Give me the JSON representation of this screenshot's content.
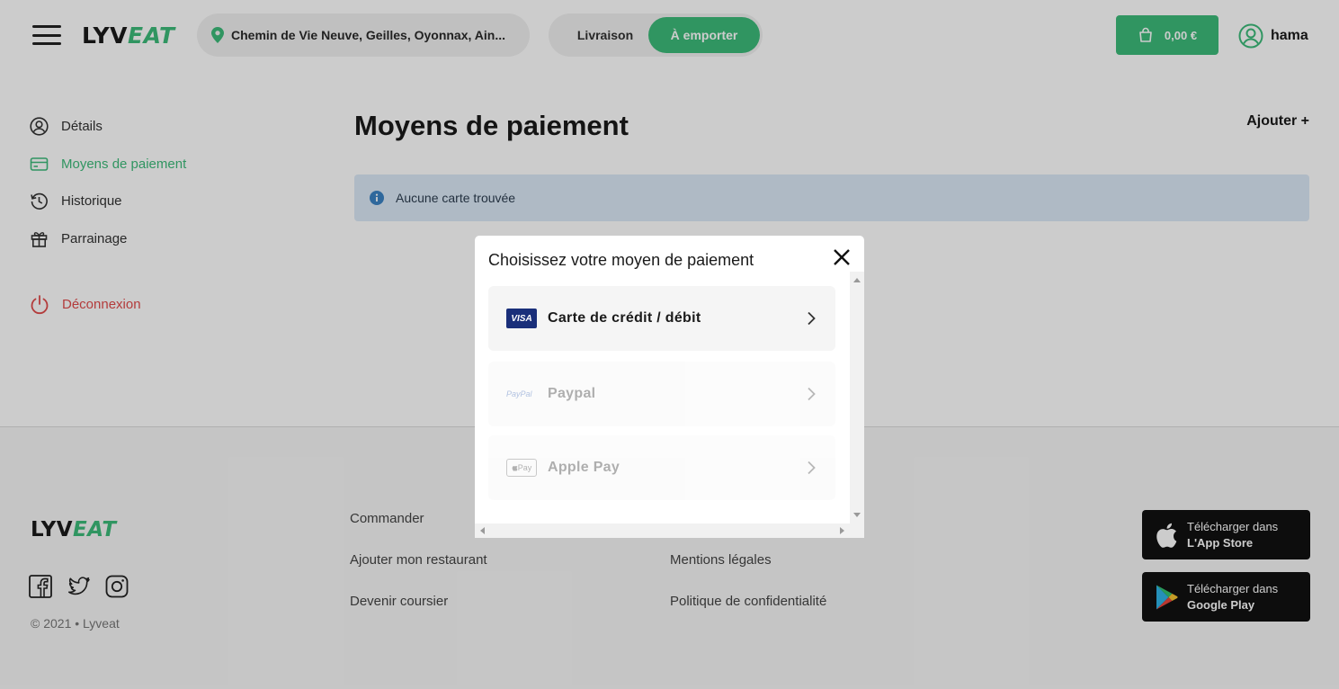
{
  "header": {
    "logo_lyv": "LYV",
    "logo_eat": "EAT",
    "address": "Chemin de Vie Neuve, Geilles, Oyonnax, Ain...",
    "mode_delivery": "Livraison",
    "mode_takeaway": "À emporter",
    "cart_total": "0,00 €",
    "username": "hama"
  },
  "sidebar": {
    "items": [
      {
        "label": "Détails",
        "icon": "user-circle-icon"
      },
      {
        "label": "Moyens de paiement",
        "icon": "credit-card-icon"
      },
      {
        "label": "Historique",
        "icon": "history-icon"
      },
      {
        "label": "Parrainage",
        "icon": "gift-icon"
      }
    ],
    "logout": "Déconnexion"
  },
  "main": {
    "title": "Moyens de paiement",
    "add_label": "Ajouter +",
    "alert": "Aucune carte trouvée"
  },
  "modal": {
    "title": "Choisissez votre moyen de paiement",
    "options": [
      {
        "label": "Carte de crédit / débit",
        "badge": "VISA",
        "enabled": true
      },
      {
        "label": "Paypal",
        "badge": "PayPal",
        "enabled": false
      },
      {
        "label": "Apple Pay",
        "badge": "Pay",
        "enabled": false
      }
    ]
  },
  "footer": {
    "logo_lyv": "LYV",
    "logo_eat": "EAT",
    "copyright": "© 2021 • Lyveat",
    "col1": [
      "Commander",
      "Ajouter mon restaurant",
      "Devenir coursier"
    ],
    "col2": [
      "Mentions légales",
      "Politique de confidentialité"
    ],
    "appstore": {
      "line1": "Télécharger dans",
      "line2": "L'App Store"
    },
    "googleplay": {
      "line1": "Télécharger dans",
      "line2": "Google Play"
    }
  },
  "colors": {
    "accent": "#3dbb7a",
    "danger": "#e04b4b",
    "alert_bg": "#dbe9f7"
  }
}
